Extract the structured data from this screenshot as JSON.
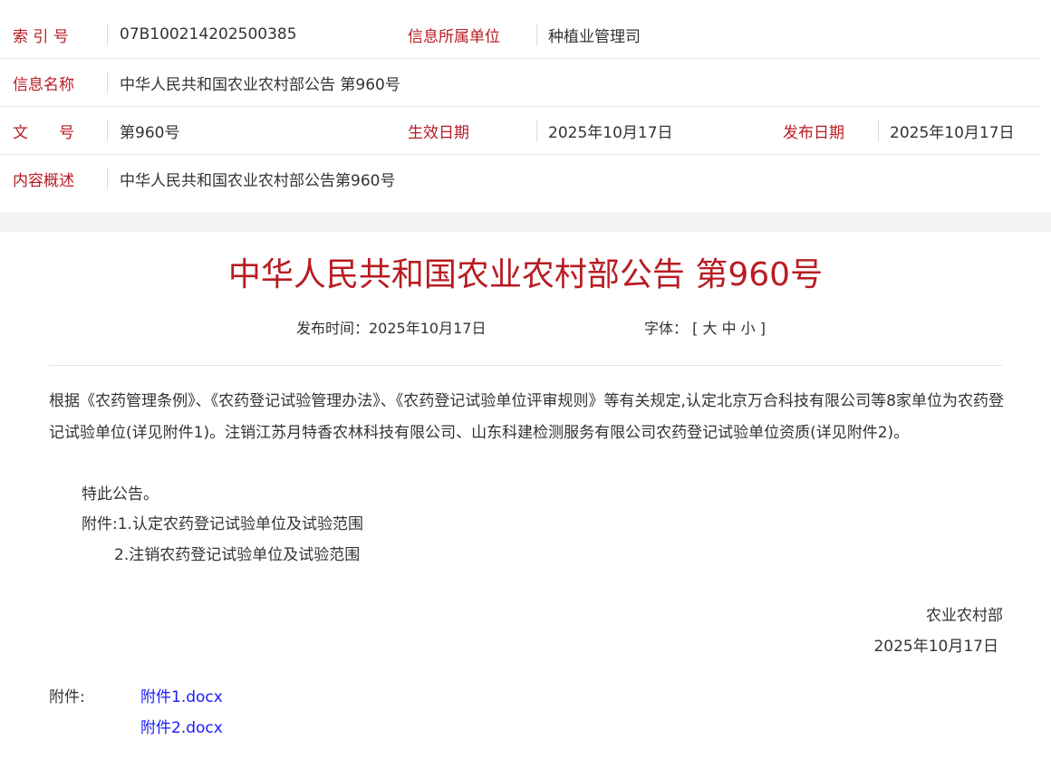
{
  "meta": {
    "index_label": "索 引 号",
    "index_value": "07B100214202500385",
    "unit_label": "信息所属单位",
    "unit_value": "种植业管理司",
    "name_label": "信息名称",
    "name_value": "中华人民共和国农业农村部公告 第960号",
    "docno_label": "文　　号",
    "docno_value": "第960号",
    "effective_label": "生效日期",
    "effective_value": "2025年10月17日",
    "publish_label": "发布日期",
    "publish_value": "2025年10月17日",
    "summary_label": "内容概述",
    "summary_value": "中华人民共和国农业农村部公告第960号"
  },
  "article": {
    "title": "中华人民共和国农业农村部公告 第960号",
    "pub_time": "发布时间：2025年10月17日",
    "font_label": "字体：",
    "font_open": "[",
    "font_large": "大",
    "font_medium": "中",
    "font_small": "小",
    "font_close": "]",
    "paragraph": " 根据《农药管理条例》、《农药登记试验管理办法》、《农药登记试验单位评审规则》等有关规定,认定北京万合科技有限公司等8家单位为农药登记试验单位(详见附件1)。注销江苏月特香农林科技有限公司、山东科建检测服务有限公司农药登记试验单位资质(详见附件2)。",
    "special_notice": "特此公告。",
    "attachment_line1": "附件:1.认定农药登记试验单位及试验范围",
    "attachment_line2": "2.注销农药登记试验单位及试验范围",
    "signature_org": "农业农村部",
    "signature_date": "2025年10月17日",
    "attachments_label": "附件:",
    "attachments": [
      "附件1.docx",
      "附件2.docx"
    ]
  },
  "colors": {
    "accent_red": "#b81c22",
    "link_blue": "#1a1aff",
    "text": "#333333"
  }
}
